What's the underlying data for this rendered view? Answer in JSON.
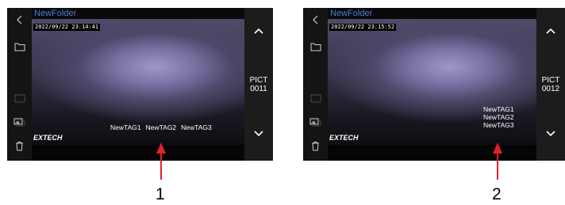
{
  "screens": [
    {
      "folder": "NewFolder",
      "timestamp": "2022/09/22 23:14:41",
      "pict": [
        "PICT",
        "0011"
      ],
      "brand": "EXTECH",
      "tags": [
        "NewTAG1",
        "NewTAG2",
        "NewTAG3"
      ],
      "tag_layout": "row"
    },
    {
      "folder": "NewFolder",
      "timestamp": "2022/09/22 23:15:52",
      "pict": [
        "PICT",
        "0012"
      ],
      "brand": "EXTECH",
      "tags": [
        "NewTAG1",
        "NewTAG2",
        "NewTAG3"
      ],
      "tag_layout": "column"
    }
  ],
  "callouts": [
    "1",
    "2"
  ],
  "icons": {
    "back": "chevron-left-icon",
    "folder": "folder-icon",
    "empty": "empty-box-icon",
    "image": "image-icon",
    "trash": "trash-icon",
    "up": "chevron-up-icon",
    "down": "chevron-down-icon"
  },
  "colors": {
    "folder_title": "#4c7bd8",
    "callout": "#e0202a"
  }
}
